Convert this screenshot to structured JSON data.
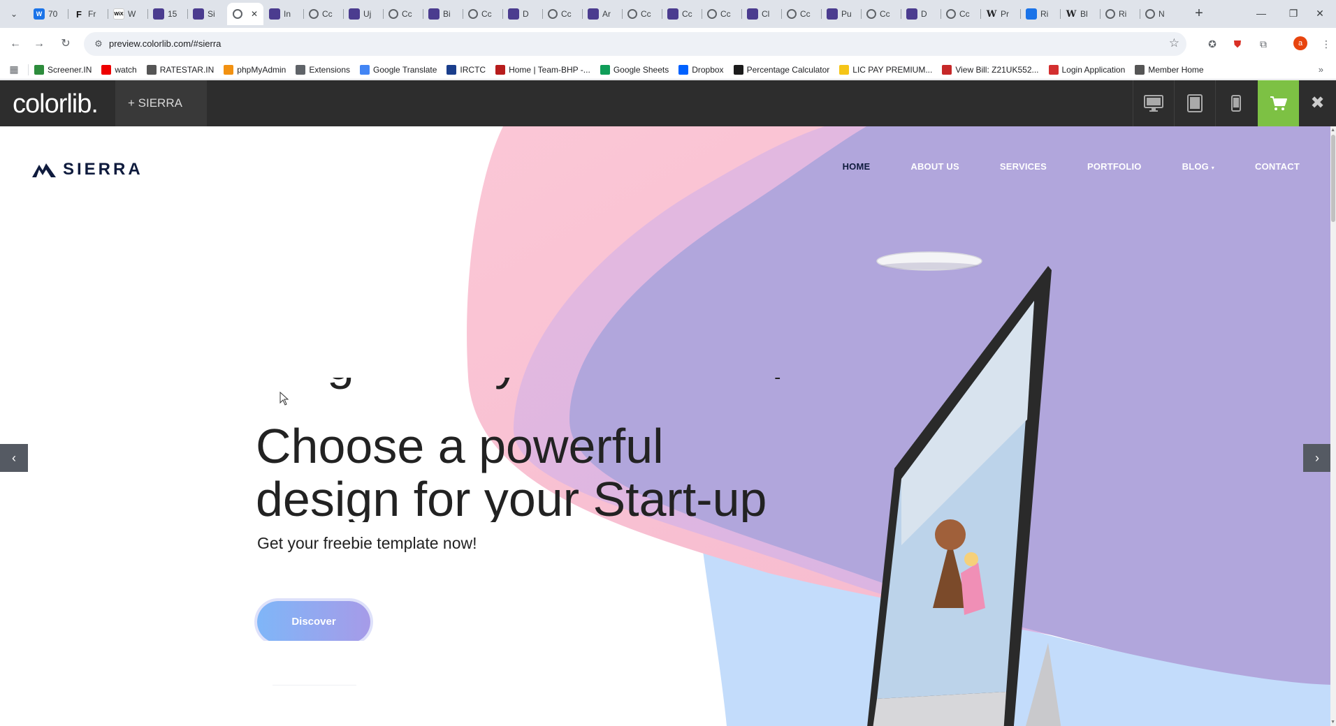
{
  "browser": {
    "tabs": [
      {
        "icon": "blue-w",
        "title": "70"
      },
      {
        "icon": "fr",
        "title": "Fr"
      },
      {
        "icon": "wix",
        "title": "W"
      },
      {
        "icon": "colorlib",
        "title": "15"
      },
      {
        "icon": "colorlib",
        "title": "Si"
      },
      {
        "icon": "globe",
        "title": "",
        "active": true
      },
      {
        "icon": "colorlib",
        "title": "In"
      },
      {
        "icon": "globe",
        "title": "Cc"
      },
      {
        "icon": "colorlib",
        "title": "Uj"
      },
      {
        "icon": "globe",
        "title": "Cc"
      },
      {
        "icon": "colorlib",
        "title": "Bi"
      },
      {
        "icon": "globe",
        "title": "Cc"
      },
      {
        "icon": "colorlib",
        "title": "D"
      },
      {
        "icon": "globe",
        "title": "Cc"
      },
      {
        "icon": "colorlib",
        "title": "Ar"
      },
      {
        "icon": "globe",
        "title": "Cc"
      },
      {
        "icon": "colorlib",
        "title": "Cc"
      },
      {
        "icon": "globe",
        "title": "Cc"
      },
      {
        "icon": "colorlib",
        "title": "Cl"
      },
      {
        "icon": "globe",
        "title": "Cc"
      },
      {
        "icon": "colorlib",
        "title": "Pu"
      },
      {
        "icon": "globe",
        "title": "Cc"
      },
      {
        "icon": "colorlib",
        "title": "D"
      },
      {
        "icon": "globe",
        "title": "Cc"
      },
      {
        "icon": "w",
        "title": "Pr"
      },
      {
        "icon": "blue",
        "title": "Ri"
      },
      {
        "icon": "w",
        "title": "Bl"
      },
      {
        "icon": "globe",
        "title": "Ri"
      },
      {
        "icon": "globe",
        "title": "N"
      }
    ],
    "url": "preview.colorlib.com/#sierra",
    "profile_initial": "a",
    "bookmarks": [
      {
        "label": "Screener.IN",
        "color": "#2d8c3c"
      },
      {
        "label": "watch",
        "color": "#e00"
      },
      {
        "label": "RATESTAR.IN",
        "color": "#555"
      },
      {
        "label": "phpMyAdmin",
        "color": "#f29111"
      },
      {
        "label": "Extensions",
        "color": "#5f6368"
      },
      {
        "label": "Google Translate",
        "color": "#4285f4"
      },
      {
        "label": "IRCTC",
        "color": "#1a3e8c"
      },
      {
        "label": "Home | Team-BHP -...",
        "color": "#b71c1c"
      },
      {
        "label": "Google Sheets",
        "color": "#0f9d58"
      },
      {
        "label": "Dropbox",
        "color": "#0061ff"
      },
      {
        "label": "Percentage Calculator",
        "color": "#1b1b1b"
      },
      {
        "label": "LIC PAY PREMIUM...",
        "color": "#f5c518"
      },
      {
        "label": "View Bill: Z21UK552...",
        "color": "#c62828"
      },
      {
        "label": "Login Application",
        "color": "#d32f2f"
      },
      {
        "label": "Member Home",
        "color": "#555"
      }
    ]
  },
  "preview_bar": {
    "logo": "colorlib.",
    "theme_label": "+ SIERRA",
    "accent": "#7dc144"
  },
  "site": {
    "logo_text": "SIERRA",
    "nav": [
      "HOME",
      "ABOUT US",
      "SERVICES",
      "PORTFOLIO",
      "BLOG",
      "CONTACT"
    ],
    "headline_line1": "Choose a powerful",
    "headline_line2": "design for your Start-up",
    "subtitle": "Get your freebie template now!",
    "cta": "Discover",
    "colors": {
      "pink": "#f8c1d3",
      "lavender": "#b1a6dc",
      "light_blue": "#bcd8fb",
      "text": "#222222"
    }
  }
}
